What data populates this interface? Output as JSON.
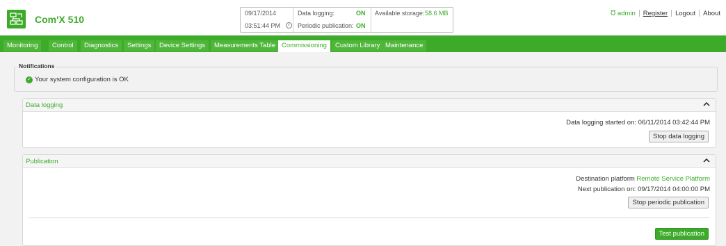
{
  "app": {
    "title": "Com'X 510",
    "logo_icon": "device-network-icon"
  },
  "status": {
    "date": "09/17/2014",
    "time": "03:51:44 PM",
    "data_logging_label": "Data logging:",
    "data_logging_value": "ON",
    "periodic_label": "Periodic publication:",
    "periodic_value": "ON",
    "storage_label": "Available storage:",
    "storage_value": "58.6 MB"
  },
  "topnav": {
    "admin": "admin",
    "register": "Register",
    "logout": "Logout",
    "about": "About"
  },
  "tabs": [
    {
      "label": "Monitoring"
    },
    {
      "label": "Control"
    },
    {
      "label": "Diagnostics"
    },
    {
      "label": "Settings"
    },
    {
      "label": "Device Settings"
    },
    {
      "label": "Measurements Table"
    },
    {
      "label": "Commissioning",
      "active": true
    },
    {
      "label": "Custom Library"
    },
    {
      "label": "Maintenance"
    }
  ],
  "notifications": {
    "legend": "Notifications",
    "message": "Your system configuration is OK"
  },
  "data_logging": {
    "title": "Data logging",
    "started_label": "Data logging started on:",
    "started_value": "06/11/2014 03:42:44 PM",
    "stop_button": "Stop data logging"
  },
  "publication": {
    "title": "Publication",
    "dest_label": "Destination platform",
    "dest_value": "Remote Service Platform",
    "next_label": "Next publication on:",
    "next_value": "09/17/2014 04:00:00 PM",
    "stop_button": "Stop periodic publication",
    "test_button": "Test publication"
  },
  "colors": {
    "brand_green": "#3dab2a",
    "background": "#f2f2f2"
  }
}
